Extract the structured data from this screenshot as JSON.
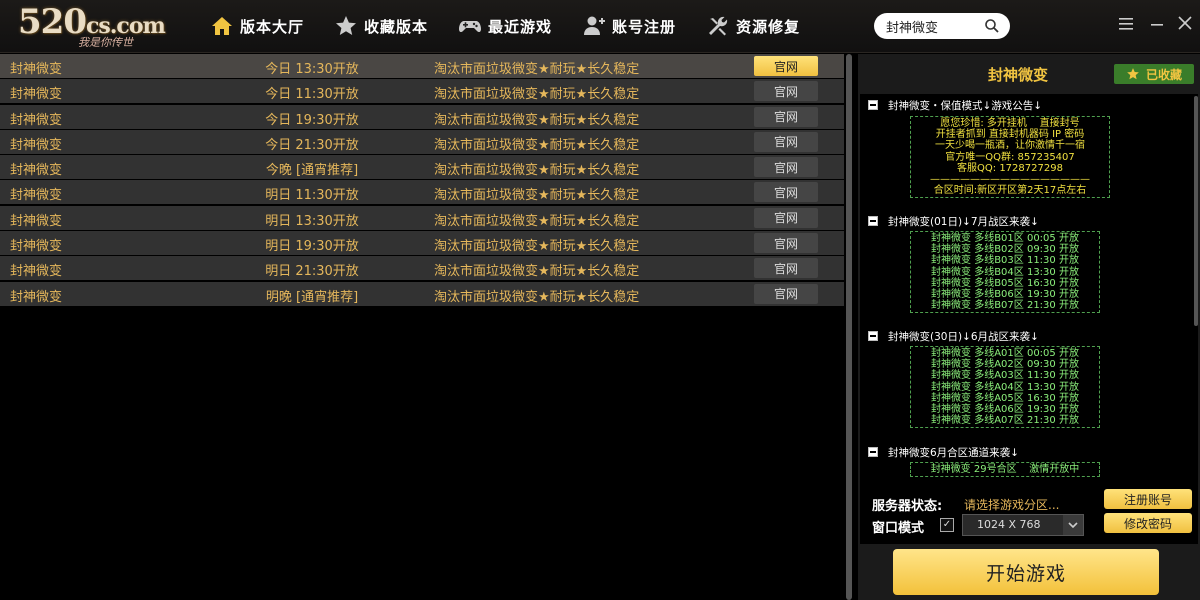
{
  "header": {
    "logo_main": "520",
    "logo_suffix": "cs.com",
    "logo_sub": "我是你传世",
    "nav": [
      {
        "label": "版本大厅",
        "icon": "home-icon"
      },
      {
        "label": "收藏版本",
        "icon": "star-icon"
      },
      {
        "label": "最近游戏",
        "icon": "gamepad-icon"
      },
      {
        "label": "账号注册",
        "icon": "user-icon"
      },
      {
        "label": "资源修复",
        "icon": "wrench-icon"
      }
    ],
    "search_value": "封神微变"
  },
  "servers": [
    {
      "name": "封神微变",
      "time": "今日 13:30开放",
      "desc": "淘汰市面垃圾微变★耐玩★长久稳定",
      "button": "官网"
    },
    {
      "name": "封神微变",
      "time": "今日 11:30开放",
      "desc": "淘汰市面垃圾微变★耐玩★长久稳定",
      "button": "官网"
    },
    {
      "name": "封神微变",
      "time": "今日 19:30开放",
      "desc": "淘汰市面垃圾微变★耐玩★长久稳定",
      "button": "官网"
    },
    {
      "name": "封神微变",
      "time": "今日 21:30开放",
      "desc": "淘汰市面垃圾微变★耐玩★长久稳定",
      "button": "官网"
    },
    {
      "name": "封神微变",
      "time": "今晚 [通宵推荐]",
      "desc": "淘汰市面垃圾微变★耐玩★长久稳定",
      "button": "官网"
    },
    {
      "name": "封神微变",
      "time": "明日 11:30开放",
      "desc": "淘汰市面垃圾微变★耐玩★长久稳定",
      "button": "官网"
    },
    {
      "name": "封神微变",
      "time": "明日 13:30开放",
      "desc": "淘汰市面垃圾微变★耐玩★长久稳定",
      "button": "官网"
    },
    {
      "name": "封神微变",
      "time": "明日 19:30开放",
      "desc": "淘汰市面垃圾微变★耐玩★长久稳定",
      "button": "官网"
    },
    {
      "name": "封神微变",
      "time": "明日 21:30开放",
      "desc": "淘汰市面垃圾微变★耐玩★长久稳定",
      "button": "官网"
    },
    {
      "name": "封神微变",
      "time": "明晚 [通宵推荐]",
      "desc": "淘汰市面垃圾微变★耐玩★长久稳定",
      "button": "官网"
    }
  ],
  "panel": {
    "title": "封神微变",
    "favorited_label": "已收藏",
    "sections": [
      {
        "heading": "封神微变・保值模式↓游戏公告↓",
        "lines": [
          "愿您珍惜: 多开挂机    直接封号",
          "开挂者抓到 直接封机器码 IP 密码",
          "一天少喝一瓶酒，让你激情千一宿",
          "官方唯一QQ群: 857235407",
          "客服QQ: 1728727298",
          "————————————————",
          "合区时间:新区开区第2天17点左右"
        ]
      },
      {
        "heading": "封神微变(01日)↓7月战区来袭↓",
        "lines": [
          "封神微变 多线B01区 00:05 开放",
          "封神微变 多线B02区 09:30 开放",
          "封神微变 多线B03区 11:30 开放",
          "封神微变 多线B04区 13:30 开放",
          "封神微变 多线B05区 16:30 开放",
          "封神微变 多线B06区 19:30 开放",
          "封神微变 多线B07区 21:30 开放"
        ]
      },
      {
        "heading": "封神微变(30日)↓6月战区来袭↓",
        "lines": [
          "封神微变 多线A01区 00:05 开放",
          "封神微变 多线A02区 09:30 开放",
          "封神微变 多线A03区 11:30 开放",
          "封神微变 多线A04区 13:30 开放",
          "封神微变 多线A05区 16:30 开放",
          "封神微变 多线A06区 19:30 开放",
          "封神微变 多线A07区 21:30 开放"
        ]
      },
      {
        "heading": "封神微变6月合区通道来袭↓",
        "lines": [
          "封神微变 29号合区    激情开放中"
        ]
      }
    ],
    "status_label": "服务器状态:",
    "status_value": "请选择游戏分区...",
    "window_mode_label": "窗口模式",
    "window_mode_checked": "✓",
    "resolution": "1024 X 768",
    "register_label": "注册账号",
    "change_password_label": "修改密码",
    "start_label": "开始游戏"
  }
}
